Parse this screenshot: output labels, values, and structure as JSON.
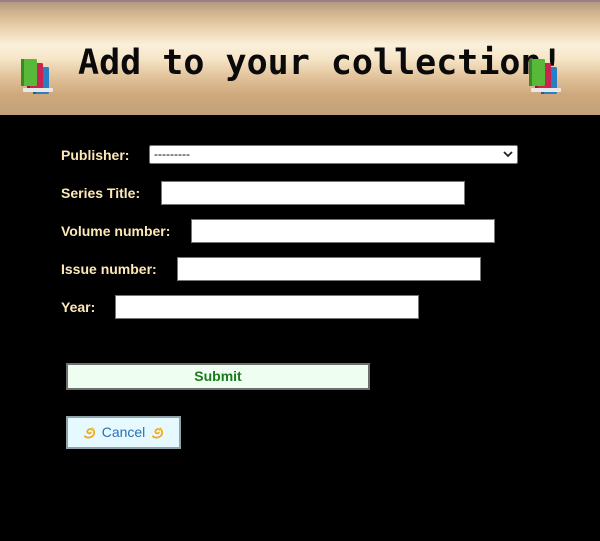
{
  "header": {
    "title": "Add to your collection!",
    "left_icon": "books-icon",
    "right_icon": "books-icon"
  },
  "form": {
    "publisher": {
      "label": "Publisher:",
      "selected": "---------"
    },
    "series_title": {
      "label": "Series Title:",
      "value": ""
    },
    "volume_number": {
      "label": "Volume number:",
      "value": ""
    },
    "issue_number": {
      "label": "Issue number:",
      "value": ""
    },
    "year": {
      "label": "Year:",
      "value": ""
    }
  },
  "actions": {
    "submit_label": "Submit",
    "cancel_label": "Cancel",
    "cancel_icon": "dizzy-icon"
  },
  "colors": {
    "background": "#000000",
    "label_text": "#fde9b8",
    "submit_text": "#1b7a1b",
    "submit_bg": "#eefff1",
    "cancel_text": "#2a6fb6",
    "cancel_bg": "#e6f9ff"
  }
}
